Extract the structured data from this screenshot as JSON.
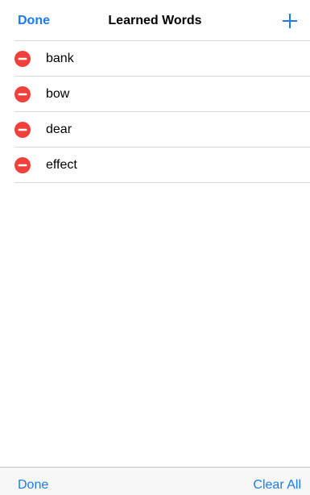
{
  "nav": {
    "done_label": "Done",
    "title": "Learned Words",
    "add_icon": "plus-icon"
  },
  "words": [
    {
      "label": "bank"
    },
    {
      "label": "bow"
    },
    {
      "label": "dear"
    },
    {
      "label": "effect"
    }
  ],
  "row_icon": "minus-circle-icon",
  "toolbar": {
    "done_label": "Done",
    "clear_all_label": "Clear All"
  },
  "colors": {
    "accent": "#1a7cf0",
    "delete": "#f0403a",
    "separator": "#d8d8d8",
    "toolbar_bg": "#f7f7f7"
  }
}
